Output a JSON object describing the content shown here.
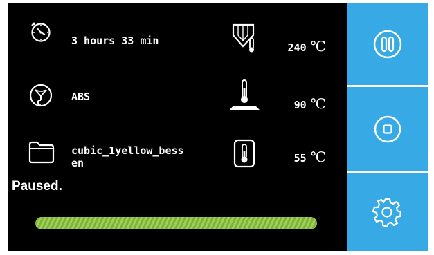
{
  "print": {
    "time_remaining": "3 hours 33 min",
    "material": "ABS",
    "file_name": "cubic_1yellow_bess\nen",
    "status": "Paused.",
    "progress": 1.0
  },
  "temperatures": {
    "nozzle": {
      "value": "240",
      "unit": "℃"
    },
    "bed": {
      "value": "90",
      "unit": "℃"
    },
    "chamber": {
      "value": "55",
      "unit": "℃"
    }
  },
  "icons": {
    "time": "stopwatch-icon",
    "material": "filament-spool-icon",
    "file": "folder-icon",
    "nozzle": "nozzle-temperature-icon",
    "bed": "heated-bed-icon",
    "chamber": "chamber-thermometer-icon",
    "pause": "pause-icon",
    "stop": "stop-icon",
    "settings": "gear-icon"
  },
  "colors": {
    "screen_bg": "#000000",
    "sidebar": "#37aae6",
    "progress": "#9fd05a",
    "text": "#ffffff"
  }
}
